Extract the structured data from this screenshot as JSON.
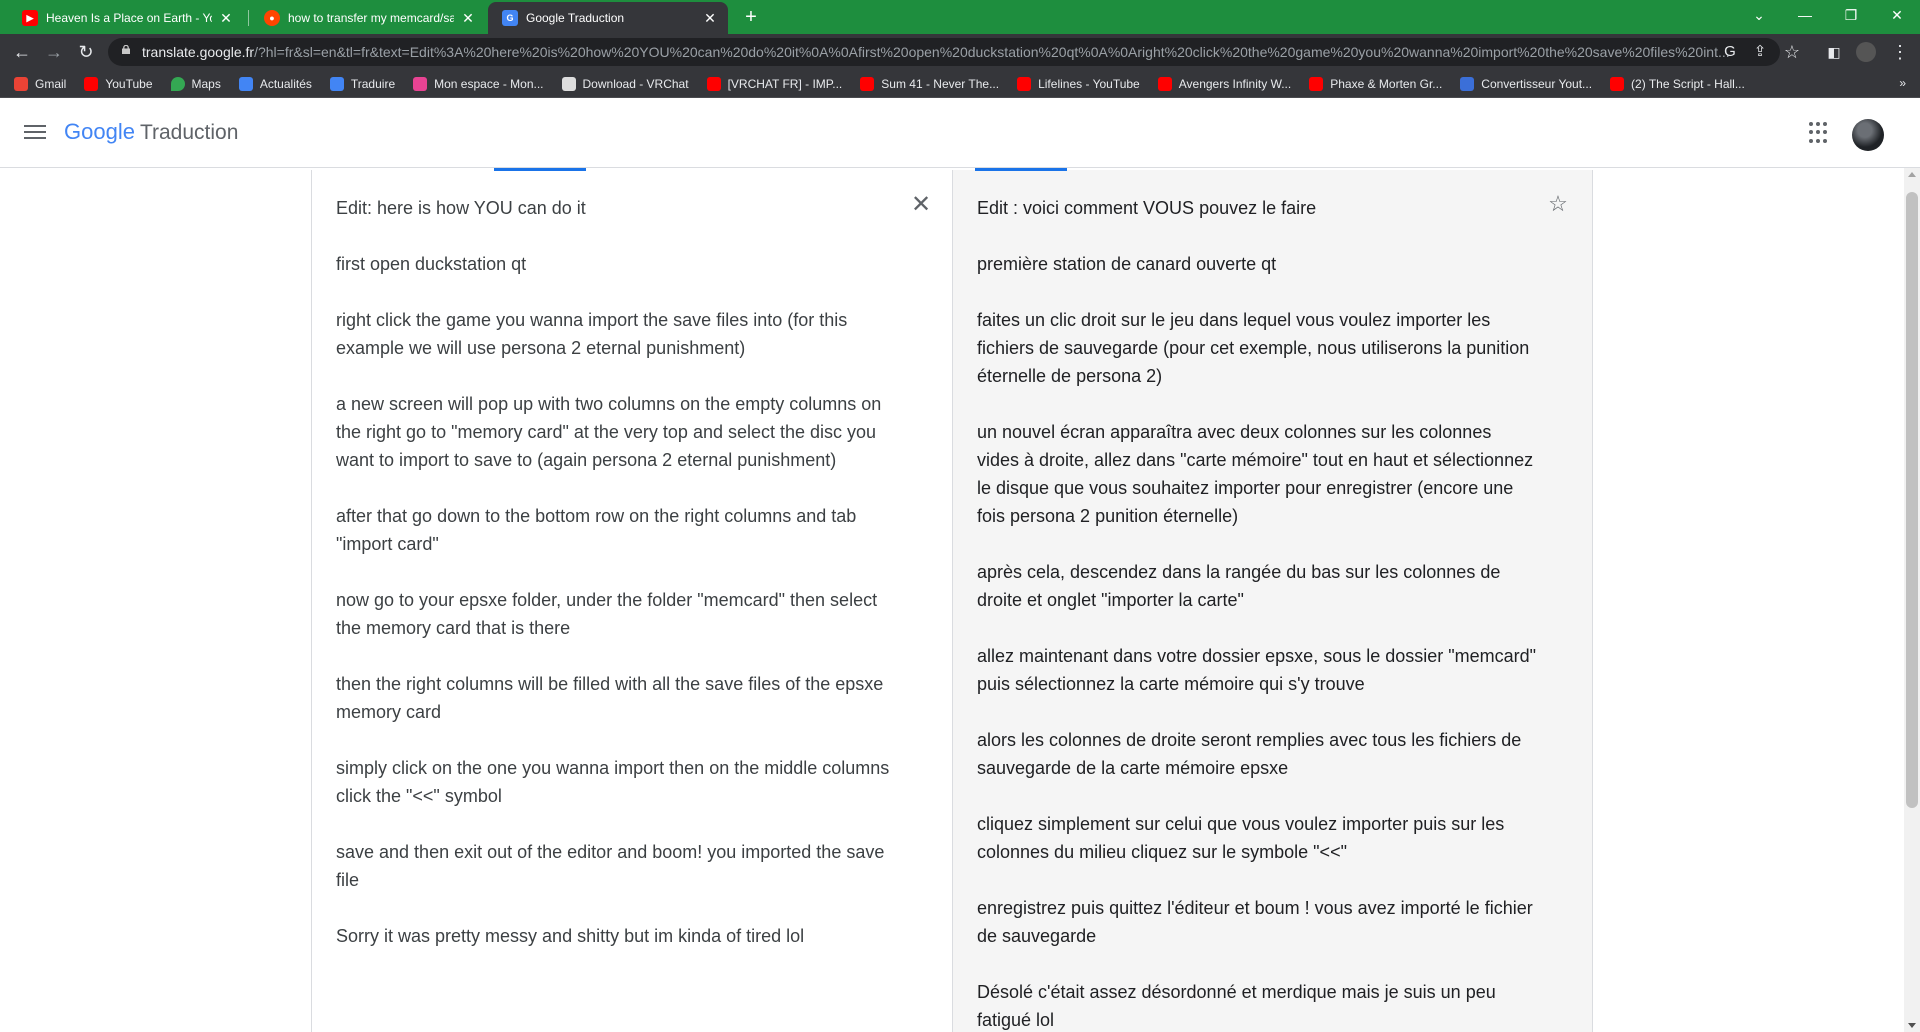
{
  "browser": {
    "tabs": [
      {
        "title": "Heaven Is a Place on Earth - YouT",
        "favicon": "youtube-icon"
      },
      {
        "title": "how to transfer my memcard/sav",
        "favicon": "reddit-icon"
      },
      {
        "title": "Google Traduction",
        "favicon": "google-translate-icon",
        "active": true
      }
    ],
    "new_tab_label": "+",
    "url_host": "translate.google.fr",
    "url_rest": "/?hl=fr&sl=en&tl=fr&text=Edit%3A%20here%20is%20how%20YOU%20can%20do%20it%0A%0Afirst%20open%20duckstation%20qt%0A%0Aright%20click%20the%20game%20you%20wanna%20import%20the%20save%20files%20int...",
    "bookmarks": [
      {
        "label": "Gmail",
        "icon": "gmail-icon",
        "color": "#ea4335"
      },
      {
        "label": "YouTube",
        "icon": "youtube-icon",
        "color": "#ff0000"
      },
      {
        "label": "Maps",
        "icon": "maps-icon",
        "color": "#34a853"
      },
      {
        "label": "Actualités",
        "icon": "news-icon",
        "color": "#4285f4"
      },
      {
        "label": "Traduire",
        "icon": "translate-icon",
        "color": "#4285f4"
      },
      {
        "label": "Mon espace - Mon...",
        "icon": "mon-espace-icon",
        "color": "#e84393"
      },
      {
        "label": "Download - VRChat",
        "icon": "vrchat-icon",
        "color": "#dddddd"
      },
      {
        "label": "[VRCHAT FR] - IMP...",
        "icon": "youtube-icon",
        "color": "#ff0000"
      },
      {
        "label": "Sum 41 - Never The...",
        "icon": "youtube-icon",
        "color": "#ff0000"
      },
      {
        "label": "Lifelines - YouTube",
        "icon": "youtube-icon",
        "color": "#ff0000"
      },
      {
        "label": "Avengers Infinity W...",
        "icon": "youtube-icon",
        "color": "#ff0000"
      },
      {
        "label": "Phaxe & Morten Gr...",
        "icon": "youtube-icon",
        "color": "#ff0000"
      },
      {
        "label": "Convertisseur Yout...",
        "icon": "converter-icon",
        "color": "#3b6fd8"
      },
      {
        "label": "(2) The Script - Hall...",
        "icon": "youtube-icon",
        "color": "#ff0000"
      }
    ],
    "bookmarks_more": "»"
  },
  "app": {
    "logo_word": "Google",
    "logo_suffix": "Traduction"
  },
  "source": {
    "paragraphs": [
      "Edit: here is how YOU can do it",
      "first open duckstation qt",
      "right click the game you wanna import the save files into (for this example we will use persona 2 eternal punishment)",
      "a new screen will pop up with two columns on the empty columns on the right go to \"memory card\" at the very top and select the disc you want to import to save to (again persona 2 eternal punishment)",
      "after that go down to the bottom row on the right columns and tab \"import card\"",
      "now go to your epsxe folder, under the folder \"memcard\" then select the memory card that is there",
      "then the right columns will be filled with all the save files of the epsxe memory card",
      "simply click on the one you wanna import then on the middle columns click the \"<<\" symbol",
      "save and then exit out of the editor and boom! you imported the save file",
      "Sorry it was pretty messy and shitty but im kinda of tired lol"
    ]
  },
  "target": {
    "paragraphs": [
      "Edit : voici comment VOUS pouvez le faire",
      "première station de canard ouverte qt",
      "faites un clic droit sur le jeu dans lequel vous voulez importer les fichiers de sauvegarde (pour cet exemple, nous utiliserons la punition éternelle de persona 2)",
      "un nouvel écran apparaîtra avec deux colonnes sur les colonnes vides à droite, allez dans \"carte mémoire\" tout en haut et sélectionnez le disque que vous souhaitez importer pour enregistrer (encore une fois persona 2 punition éternelle)",
      "après cela, descendez dans la rangée du bas sur les colonnes de droite et onglet \"importer la carte\"",
      "allez maintenant dans votre dossier epsxe, sous le dossier \"memcard\" puis sélectionnez la carte mémoire qui s'y trouve",
      "alors les colonnes de droite seront remplies avec tous les fichiers de sauvegarde de la carte mémoire epsxe",
      "cliquez simplement sur celui que vous voulez importer puis sur les colonnes du milieu cliquez sur le symbole \"<<\"",
      "enregistrez puis quittez l'éditeur et boum ! vous avez importé le fichier de sauvegarde",
      "Désolé c'était assez désordonné et merdique mais je suis un peu fatigué lol"
    ]
  },
  "colors": {
    "tab_strip": "#1e8e3e",
    "toolbar": "#35363a",
    "accent": "#1a73e8"
  }
}
